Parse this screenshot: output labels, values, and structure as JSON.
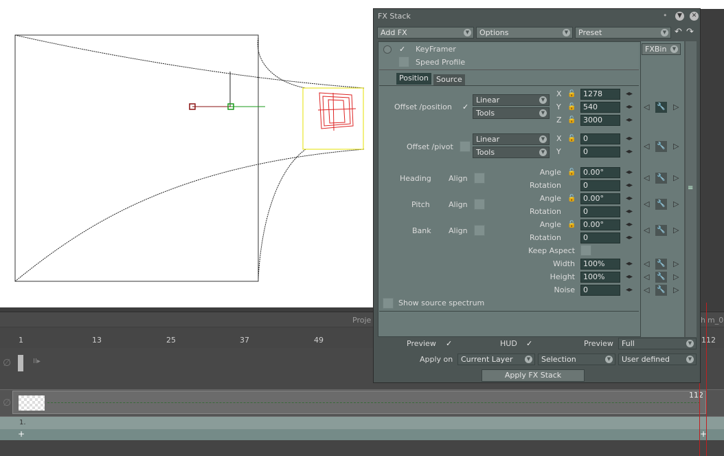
{
  "timeline": {
    "header_left": "Proje",
    "header_right": "him_0",
    "ticks": [
      "1",
      "13",
      "25",
      "37",
      "49",
      "112"
    ],
    "track_end_label": "112",
    "track3_label": "1.",
    "plus_left": "+",
    "plus_right": "+"
  },
  "fx_stack": {
    "title": "FX Stack",
    "toolbar": {
      "add_fx": "Add FX",
      "options": "Options",
      "preset": "Preset"
    },
    "effect": {
      "name": "KeyFramer",
      "speed_profile": "Speed Profile",
      "fxbin": "FXBin"
    },
    "tabs": {
      "position": "Position",
      "source": "Source"
    },
    "offset_position": {
      "label": "Offset /position",
      "interp": "Linear",
      "tools": "Tools",
      "x_label": "X",
      "x": "1278",
      "y_label": "Y",
      "y": "540",
      "z_label": "Z",
      "z": "3000"
    },
    "offset_pivot": {
      "label": "Offset /pivot",
      "interp": "Linear",
      "tools": "Tools",
      "x_label": "X",
      "x": "0",
      "y_label": "Y",
      "y": "0"
    },
    "heading": {
      "label": "Heading",
      "align": "Align",
      "angle_label": "Angle",
      "angle": "0.00°",
      "rotation_label": "Rotation",
      "rotation": "0"
    },
    "pitch": {
      "label": "Pitch",
      "align": "Align",
      "angle_label": "Angle",
      "angle": "0.00°",
      "rotation_label": "Rotation",
      "rotation": "0"
    },
    "bank": {
      "label": "Bank",
      "align": "Align",
      "angle_label": "Angle",
      "angle": "0.00°",
      "rotation_label": "Rotation",
      "rotation": "0"
    },
    "keep_aspect": "Keep Aspect",
    "width": {
      "label": "Width",
      "value": "100%"
    },
    "height": {
      "label": "Height",
      "value": "100%"
    },
    "noise": {
      "label": "Noise",
      "value": "0"
    },
    "show_source_spectrum": "Show source spectrum",
    "footer": {
      "preview_label": "Preview",
      "hud_label": "HUD",
      "preview2_label": "Preview",
      "preview_mode": "Full",
      "apply_on_label": "Apply on",
      "apply_layer": "Current Layer",
      "apply_selection": "Selection",
      "apply_defined": "User defined",
      "apply_button": "Apply FX Stack"
    }
  },
  "colors": {
    "panel_bg": "#6a7a78",
    "field_bg": "#2f4341",
    "canvas_bg": "#ffffff",
    "playhead": "#c02020",
    "motion_box": "#e6e000"
  }
}
